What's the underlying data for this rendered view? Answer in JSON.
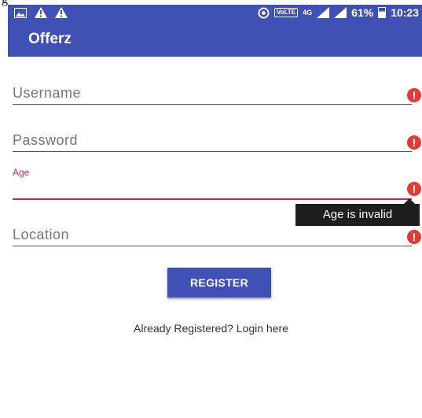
{
  "top_fragment": "g",
  "status_bar": {
    "lte": "VoLTE",
    "network": "4G",
    "battery": "61%",
    "time": "10:23",
    "battery_level": 0.61
  },
  "app_bar": {
    "title": "Offerz"
  },
  "form": {
    "username": {
      "placeholder": "Username"
    },
    "password": {
      "placeholder": "Password"
    },
    "age": {
      "label": "Age",
      "value": ""
    },
    "location": {
      "placeholder": "Location"
    },
    "error_tooltip": "Age is invalid",
    "error_icon": "!"
  },
  "register_label": "REGISTER",
  "login_link": "Already Registered? Login here",
  "colors": {
    "primary": "#3f51b5",
    "accent": "#d81b60",
    "error": "#e53935"
  }
}
